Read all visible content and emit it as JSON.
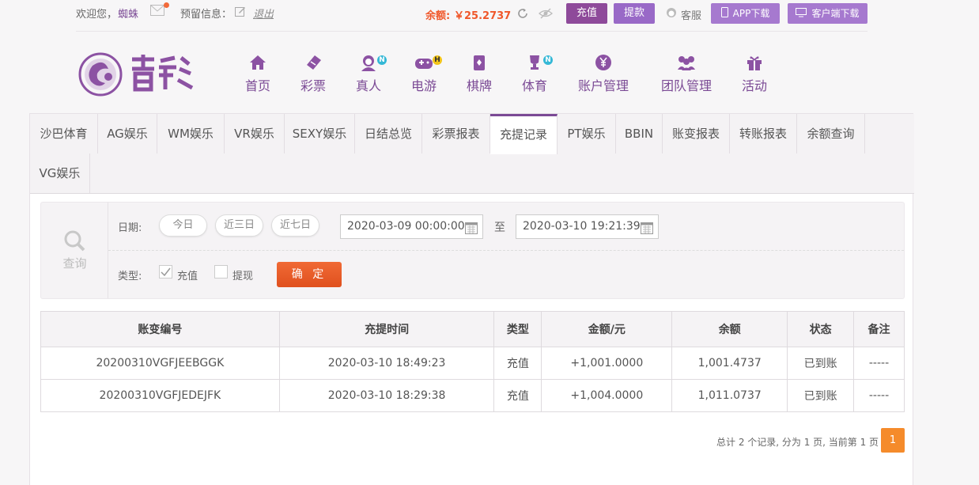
{
  "topbar": {
    "welcome": "欢迎您，",
    "username": "蜘蛛",
    "notice_label": "预留信息：",
    "logout": "退出",
    "balance_label": "余额:",
    "balance_value": "￥25.2737",
    "deposit": "充值",
    "withdraw": "提款",
    "customer_service": "客服",
    "app_download": "APP下载",
    "client_download": "客户端下载"
  },
  "colors": {
    "brand": "#7b4a95",
    "accent": "#f0572a",
    "positive": "#d1191d",
    "status_ok": "#3aa335"
  },
  "nav": [
    {
      "label": "首页",
      "icon": "home-icon"
    },
    {
      "label": "彩票",
      "icon": "ticket-icon"
    },
    {
      "label": "真人",
      "icon": "dealer-icon",
      "badge": "N"
    },
    {
      "label": "电游",
      "icon": "gamepad-icon",
      "badge": "H"
    },
    {
      "label": "棋牌",
      "icon": "cards-icon"
    },
    {
      "label": "体育",
      "icon": "trophy-icon",
      "badge": "N"
    },
    {
      "label": "账户管理",
      "icon": "yen-coin-icon"
    },
    {
      "label": "团队管理",
      "icon": "team-icon"
    },
    {
      "label": "活动",
      "icon": "gift-icon"
    }
  ],
  "tabs": [
    "沙巴体育",
    "AG娱乐",
    "WM娱乐",
    "VR娱乐",
    "SEXY娱乐",
    "日结总览",
    "彩票报表",
    "充提记录",
    "PT娱乐",
    "BBIN",
    "账变报表",
    "转账报表",
    "余额查询",
    "VG娱乐"
  ],
  "active_tab": "充提记录",
  "filter": {
    "query_label": "查询",
    "date_label": "日期:",
    "quick": [
      "今日",
      "近三日",
      "近七日"
    ],
    "start": "2020-03-09 00:00:00",
    "to": "至",
    "end": "2020-03-10 19:21:39",
    "type_label": "类型:",
    "types": [
      {
        "label": "充值",
        "checked": true
      },
      {
        "label": "提现",
        "checked": false
      }
    ],
    "confirm": "确 定"
  },
  "table": {
    "headers": [
      "账变编号",
      "充提时间",
      "类型",
      "金额/元",
      "余额",
      "状态",
      "备注"
    ],
    "rows": [
      [
        "20200310VGFJEEBGGK",
        "2020-03-10 18:49:23",
        "充值",
        "+1,001.0000",
        "1,001.4737",
        "已到账",
        "-----"
      ],
      [
        "20200310VGFJEDEJFK",
        "2020-03-10 18:29:38",
        "充值",
        "+1,004.0000",
        "1,011.0737",
        "已到账",
        "-----"
      ]
    ]
  },
  "pager": {
    "summary": "总计 2 个记录, 分为 1 页, 当前第 1 页",
    "current": "1"
  }
}
